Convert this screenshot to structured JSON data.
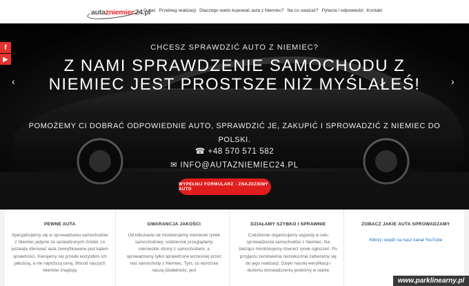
{
  "header": {
    "logo_prefix": "auta",
    "logo_mid": "zniemiec",
    "logo_suffix": "24.pl",
    "nav": [
      "O nas",
      "Przebieg realizacji",
      "Dlaczego warto kupować auta z Niemiec?",
      "Na co uważać?",
      "Pytania i odpowiedzi",
      "Kontakt"
    ]
  },
  "social": {
    "facebook": "f",
    "youtube": "▶"
  },
  "hero": {
    "pretitle": "CHCESZ SPRAWDZIĆ AUTO Z NIEMIEC?",
    "headline": "Z NAMI SPRAWDZENIE SAMOCHODU Z NIEMIEC JEST PROSTSZE NIŻ MYŚLAŁEŚ!",
    "subtitle": "POMOŻEMY CI DOBRAĆ ODPOWIEDNIE AUTO, SPRAWDZIĆ JE, ZAKUPIĆ I SPROWADZIĆ Z NIEMIEC DO POLSKI.",
    "phone": "☎ +48 570 571 582",
    "email": "✉ INFO@AUTAZNIEMIEC24.PL",
    "cta": "WYPEŁNIJ FORMULARZ - ZNAJDZIEMY AUTO",
    "prev": "‹",
    "next": "›"
  },
  "features": [
    {
      "title": "PEWNE AUTA",
      "text": "Specjalizujemy się w sprowadzaniu samochodów z Niemiec jedynie ze sprawdzonych źródeł, co pozwala oferować auta zweryfikowane pod kątem sprawności. Kierujemy się przede wszystkim ich jakością, a nie najniższą ceną. Wśród naszych klientów znajdują"
    },
    {
      "title": "GWARANCJA JAKOŚCI",
      "text": "Od kilkunastu lat monitorujemy niemiecki rynek samochodowy, codziennie przeglądamy niemieckie strony z samochodami, a sprowadzamy tylko sprawdzone wcześniej przez nas samochody z Niemiec. Tym, co wyróżnia naszą działalność, jest"
    },
    {
      "title": "DZIAŁAMY SZYBKO I SPRAWNIE",
      "text": "Codziennie organizujemy wyjazdy w celu sprowadzenia samochodów z Niemiec. Na bieżąco monitorujemy również rynek ogłoszeń. Po przyjęciu zamówienia niezwłocznie zabieramy się do jego realizacji. Dzięki naszej weryfikacji i dużemu doświadczeniu jesteśmy w stanie"
    },
    {
      "title": "ZOBACZ JAKIE AUTA SPROWADZAMY",
      "link": "Kliknij i wejdź na nasz kanał YouTube"
    }
  ],
  "watermark": "www.parklinearny.pl"
}
